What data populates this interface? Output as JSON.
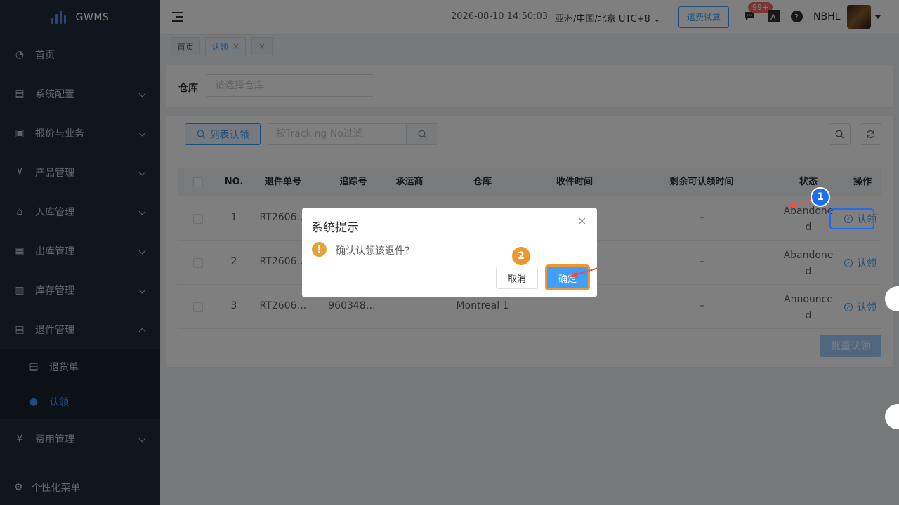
{
  "app": {
    "name": "GWMS"
  },
  "sidebar": {
    "items": [
      {
        "label": "首页",
        "icon": "dashboard-icon",
        "glyph": "◔"
      },
      {
        "label": "系统配置",
        "icon": "settings-doc-icon",
        "glyph": "▤"
      },
      {
        "label": "报价与业务",
        "icon": "quote-icon",
        "glyph": "▣"
      },
      {
        "label": "产品管理",
        "icon": "cart-icon",
        "glyph": "⊻"
      },
      {
        "label": "入库管理",
        "icon": "home-icon",
        "glyph": "⌂"
      },
      {
        "label": "出库管理",
        "icon": "grid-icon",
        "glyph": "▦"
      },
      {
        "label": "库存管理",
        "icon": "table-icon",
        "glyph": "▥"
      },
      {
        "label": "退件管理",
        "icon": "return-doc-icon",
        "glyph": "▤"
      }
    ],
    "sub_items": [
      {
        "label": "退货单",
        "icon": "document-icon",
        "glyph": "▤"
      },
      {
        "label": "认领",
        "icon": "user-icon",
        "glyph": "●"
      }
    ],
    "fee_item": {
      "label": "费用管理",
      "icon": "yen-icon",
      "glyph": "¥"
    },
    "footer": {
      "label": "个性化菜单",
      "icon": "gear-icon",
      "glyph": "⚙"
    }
  },
  "header": {
    "datetime": "2026-08-10 14:50:03",
    "timezone": "亚洲/中国/北京 UTC+8",
    "freight_button": "运费试算",
    "badge": "99+",
    "user": "NBHL"
  },
  "tags": [
    {
      "label": "首页"
    },
    {
      "label": "认领",
      "close": "×"
    },
    {
      "label": "×"
    }
  ],
  "filter": {
    "warehouse_label": "仓库",
    "warehouse_placeholder": "请选择仓库"
  },
  "toolbar": {
    "list_claim_label": "列表认领",
    "tracking_placeholder": "按Tracking No过滤"
  },
  "table": {
    "headers": [
      "NO.",
      "退件单号",
      "追踪号",
      "承运商",
      "仓库",
      "收件时间",
      "剩余可认领时间",
      "状态",
      "操作"
    ],
    "rows": [
      {
        "no": "1",
        "return_no": "RT2606…",
        "tracking": "",
        "carrier": "",
        "warehouse": "",
        "received": "",
        "remaining": "–",
        "status_1": "Abandone",
        "status_2": "d",
        "action": "认领"
      },
      {
        "no": "2",
        "return_no": "RT2606…",
        "tracking": "",
        "carrier": "",
        "warehouse": "",
        "received": "",
        "remaining": "–",
        "status_1": "Abandone",
        "status_2": "d",
        "action": "认领"
      },
      {
        "no": "3",
        "return_no": "RT2606…",
        "tracking": "960348…",
        "carrier": "",
        "warehouse": "Montreal 1",
        "received": "",
        "remaining": "–",
        "status_1": "Announce",
        "status_2": "d",
        "action": "认领"
      }
    ],
    "batch_label": "批量认领"
  },
  "dialog": {
    "title": "系统提示",
    "message": "确认认领该退件?",
    "cancel": "取消",
    "confirm": "确定",
    "close": "×",
    "warn_glyph": "!"
  },
  "annotations": {
    "step1": "1",
    "step2": "2"
  },
  "colors": {
    "primary": "#409eff",
    "sidebar_bg": "#1f2d3d",
    "warning": "#e6a23c",
    "step1": "#1e6cf0",
    "step2": "#f0962f"
  }
}
